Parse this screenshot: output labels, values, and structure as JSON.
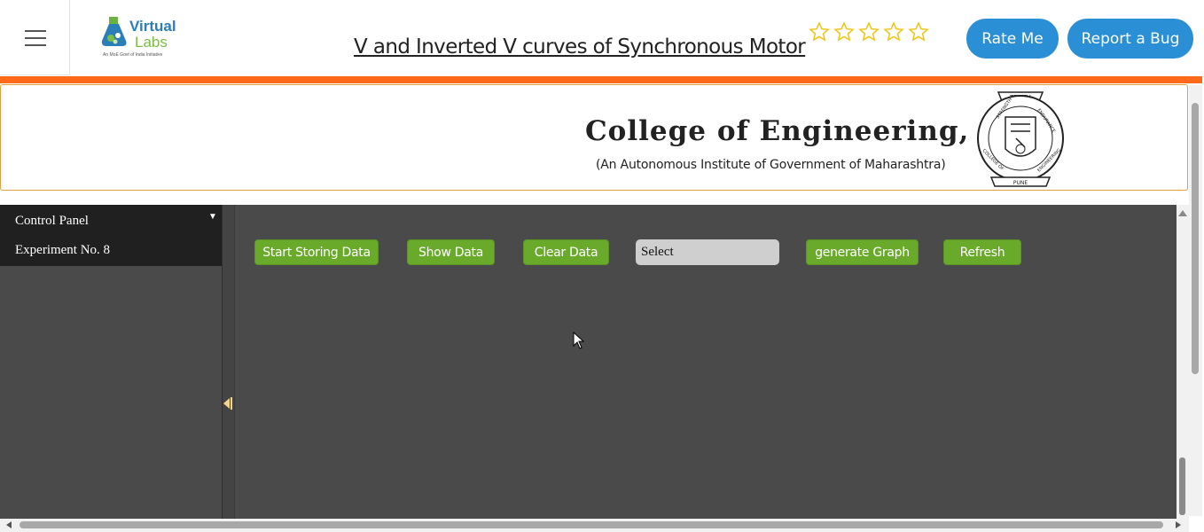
{
  "header": {
    "title": "V and Inverted V curves of Synchronous Motor",
    "logo_text_1": "Virtual",
    "logo_text_2": "Labs",
    "logo_tagline": "An MoE Govt of India Initiative",
    "rating_stars": 5,
    "rate_label": "Rate Me",
    "bug_label": "Report a Bug"
  },
  "banner": {
    "college": "College of Engineering, Pune",
    "subtitle": "(An Autonomous Institute of Government of Maharashtra)",
    "emblem_texts": [
      "TRUTH",
      "STRENGTH",
      "ENDURANCE",
      "COLLEGE OF",
      "ENGINEERING",
      "PUNE"
    ]
  },
  "panel": {
    "title": "Control Panel",
    "experiment": "Experiment No. 8"
  },
  "toolbar": {
    "start": "Start Storing Data",
    "show": "Show Data",
    "clear": "Clear Data",
    "select": "Select",
    "graph": "generate Graph",
    "refresh": "Refresh"
  },
  "colors": {
    "accent_blue": "#2a8fd4",
    "orange": "#ff6a1a",
    "green_button": "#6aaa2a",
    "panel_bg": "#4a4a4a"
  }
}
